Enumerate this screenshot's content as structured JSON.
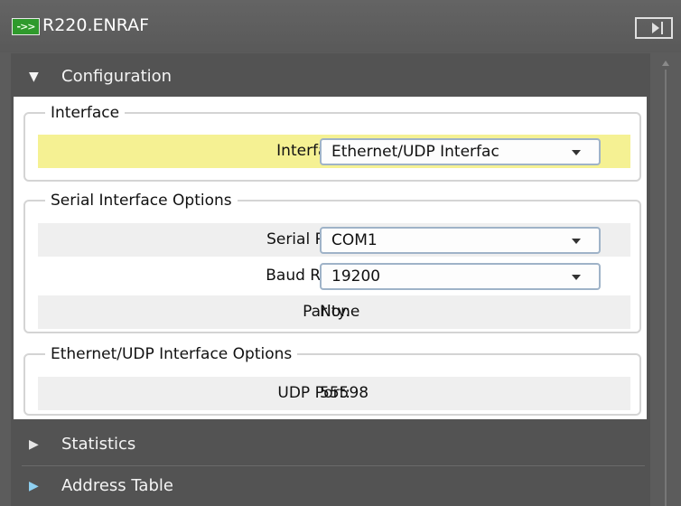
{
  "window": {
    "title": "R220.ENRAF",
    "title_icon_glyph": "->>",
    "title_icon": "device-arrow-icon"
  },
  "sections": [
    {
      "label": "Configuration",
      "expanded": true
    },
    {
      "label": "Statistics",
      "expanded": false
    },
    {
      "label": "Address Table",
      "expanded": false
    }
  ],
  "config": {
    "interface_group": {
      "legend": "Interface",
      "interface_label": "Interface:",
      "interface_value": "Ethernet/UDP Interfac"
    },
    "serial_group": {
      "legend": "Serial Interface Options",
      "serial_port_label": "Serial Port:",
      "serial_port_value": "COM1",
      "baud_rate_label": "Baud Rate:",
      "baud_rate_value": "19200",
      "parity_label": "Parity:",
      "parity_value": "None"
    },
    "ethernet_group": {
      "legend": "Ethernet/UDP Interface Options",
      "udp_port_label": "UDP Port:",
      "udp_port_value": "55598"
    }
  },
  "colors": {
    "highlight_row": "#f5f193",
    "title_icon_green": "#2f9a2c",
    "panel_bg": "#535353"
  }
}
